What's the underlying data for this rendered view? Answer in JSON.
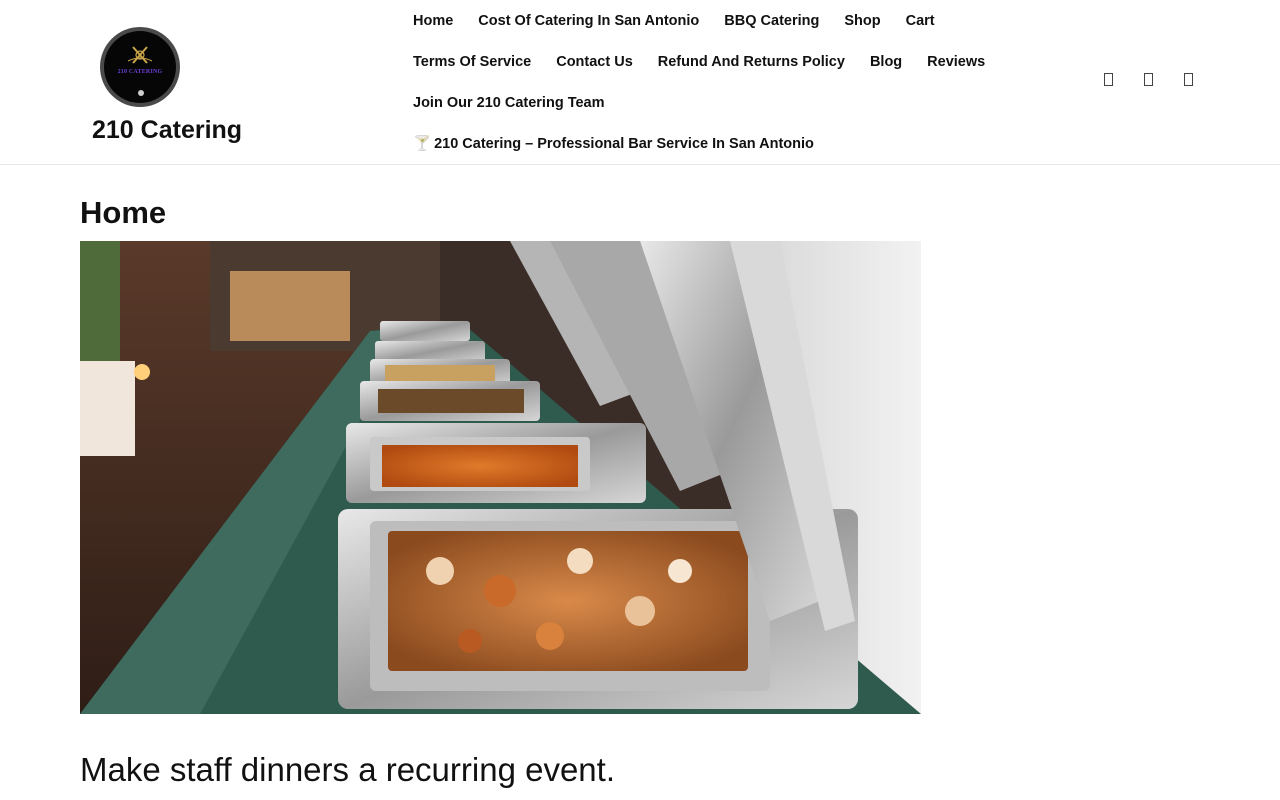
{
  "site": {
    "name": "210 Catering",
    "logo_text": "210 CATERING"
  },
  "nav": {
    "rows": [
      [
        "Home",
        "Cost Of Catering In San Antonio",
        "BBQ Catering",
        "Shop",
        "Cart"
      ],
      [
        "Terms Of Service",
        "Contact Us",
        "Refund And Returns Policy",
        "Blog",
        "Reviews"
      ],
      [
        "Join Our 210 Catering Team"
      ],
      [
        "210 Catering – Professional Bar Service In San Antonio"
      ]
    ],
    "bar_icon": "martini-glass-icon"
  },
  "header_icons": [
    "search-icon",
    "account-icon",
    "cart-icon"
  ],
  "page": {
    "title": "Home",
    "hero_subject": "buffet-chafing-dishes-photo",
    "tagline": "Make staff dinners a recurring event."
  },
  "colors": {
    "text": "#111111",
    "border": "#e6e6e6",
    "logo_accent": "#6b3fd6"
  }
}
